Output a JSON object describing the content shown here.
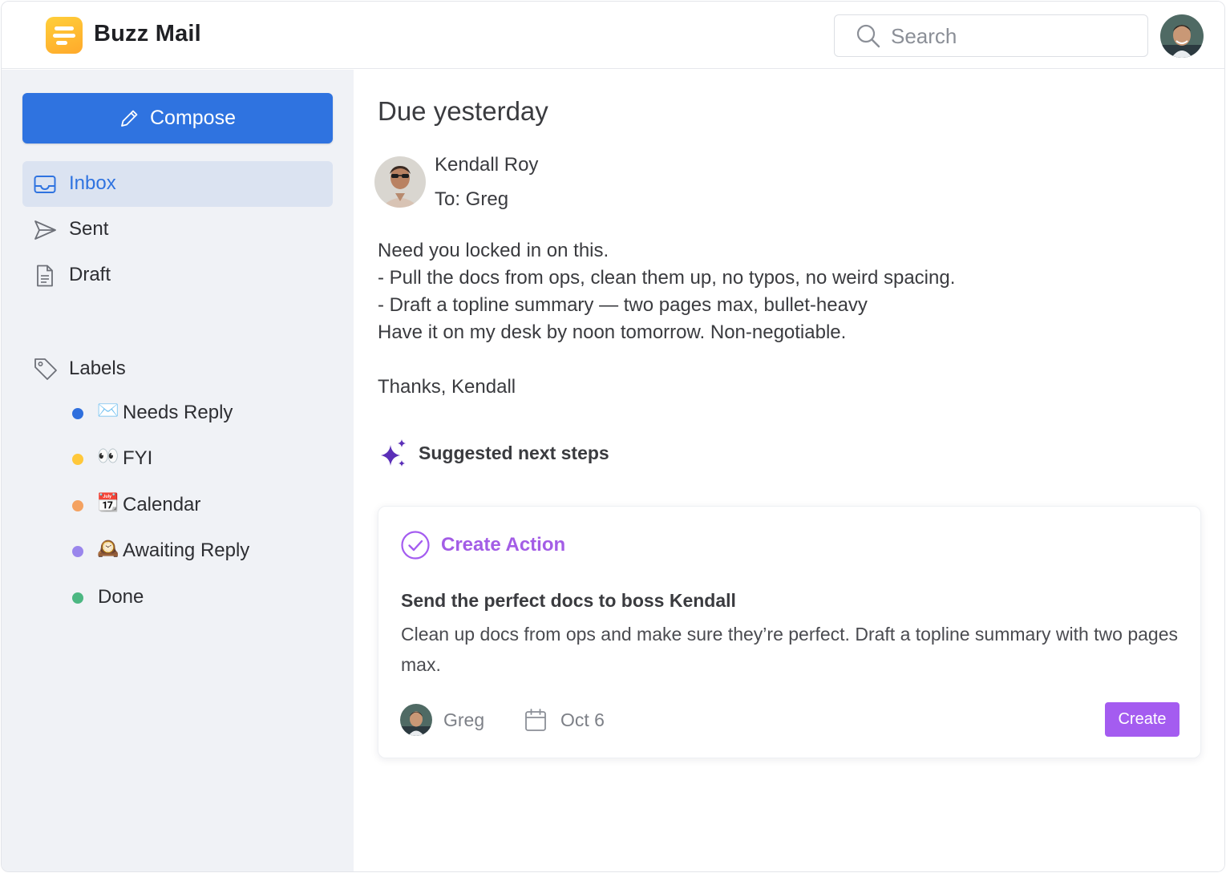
{
  "header": {
    "app_name": "Buzz Mail",
    "search_placeholder": "Search"
  },
  "sidebar": {
    "compose_label": "Compose",
    "nav": [
      {
        "label": "Inbox",
        "icon": "inbox-icon",
        "active": true
      },
      {
        "label": "Sent",
        "icon": "send-icon",
        "active": false
      },
      {
        "label": "Draft",
        "icon": "document-icon",
        "active": false
      }
    ],
    "labels_heading": "Labels",
    "labels": [
      {
        "label": "Needs Reply",
        "emoji": "✉️",
        "dot_color": "#2f6fdd"
      },
      {
        "label": "FYI",
        "emoji": "👀",
        "dot_color": "#ffc83a"
      },
      {
        "label": "Calendar",
        "emoji": "📆",
        "dot_color": "#f4a261"
      },
      {
        "label": "Awaiting Reply",
        "emoji": "🕰️",
        "dot_color": "#9a86ec"
      },
      {
        "label": "Done",
        "emoji": "",
        "dot_color": "#4cb782"
      }
    ]
  },
  "email": {
    "subject": "Due yesterday",
    "sender": "Kendall Roy",
    "to": "To: Greg",
    "body": [
      "Need you locked in on this.",
      "- Pull the docs from ops, clean them up, no typos, no weird spacing.",
      "- Draft a topline summary — two pages max, bullet-heavy",
      "Have it on my desk by noon tomorrow. Non-negotiable."
    ],
    "signoff": "Thanks, Kendall"
  },
  "suggestions": {
    "title": "Suggested next steps",
    "card": {
      "header": "Create Action",
      "task_title": "Send the perfect docs to boss Kendall",
      "task_desc": "Clean up docs from ops and make sure they’re perfect. Draft a topline summary with two pages max.",
      "assignee": "Greg",
      "due": "Oct 6",
      "button": "Create"
    }
  },
  "colors": {
    "accent_blue": "#2f73e0",
    "accent_purple": "#a45cf0",
    "sidebar_bg": "#f0f2f6",
    "active_bg": "#dbe3f1"
  }
}
